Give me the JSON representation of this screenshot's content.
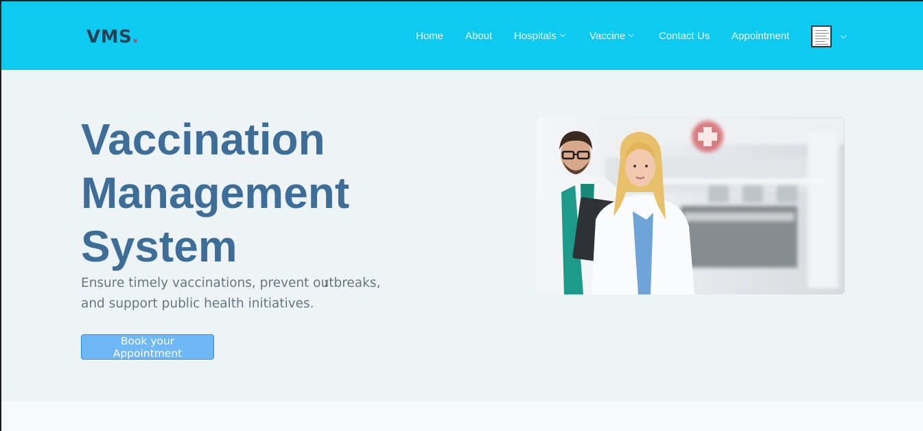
{
  "header": {
    "logo_text": "VMS",
    "logo_dot": ".",
    "nav": [
      {
        "label": "Home",
        "dropdown": false
      },
      {
        "label": "About",
        "dropdown": false
      },
      {
        "label": "Hospitals",
        "dropdown": true
      },
      {
        "label": "Vaccine",
        "dropdown": true
      },
      {
        "label": "Contact Us",
        "dropdown": false
      },
      {
        "label": "Appointment",
        "dropdown": false
      }
    ],
    "profile_icon": "user-avatar-icon"
  },
  "hero": {
    "title_lines": [
      "Vaccination",
      "Management",
      "System"
    ],
    "subtitle": "Ensure timely vaccinations, prevent outbreaks, and support public health initiatives.",
    "cta_label": "Book your Appointment",
    "image": "doctors-photo"
  },
  "colors": {
    "header_bg": "#0dcaf0",
    "hero_bg": "#eef3f6",
    "title": "#3d6e99",
    "cta_bg": "#6eb8f7",
    "logo_dot": "#e43c5c"
  }
}
